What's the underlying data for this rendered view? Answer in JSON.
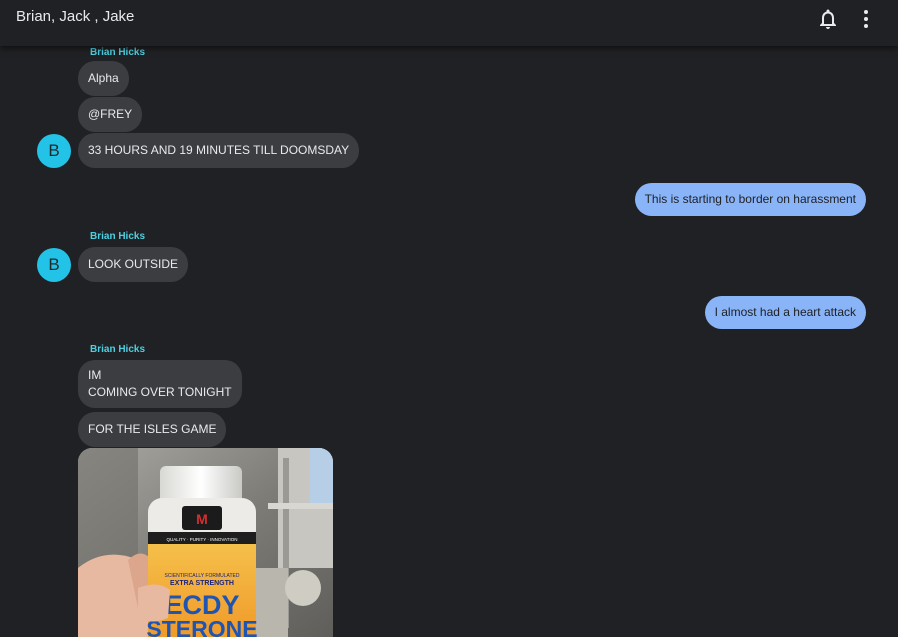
{
  "header": {
    "title": "Brian, Jack , Jake",
    "icons": [
      "bell-icon",
      "more-vert-icon"
    ]
  },
  "messages": [
    {
      "sender": "Brian Hicks",
      "avatar_letter": "B",
      "bubbles": [
        "Alpha",
        "@FREY",
        "33 HOURS AND 19 MINUTES TILL DOOMSDAY"
      ]
    },
    {
      "outgoing": "This is starting to border on harassment"
    },
    {
      "sender": "Brian Hicks",
      "avatar_letter": "B",
      "bubbles": [
        "LOOK OUTSIDE"
      ]
    },
    {
      "outgoing": "I almost had a heart attack"
    },
    {
      "sender": "Brian Hicks",
      "bubbles": [
        "IM\nCOMING OVER TONIGHT",
        "FOR THE ISLES GAME"
      ],
      "image": {
        "brand": "M",
        "label_small": "QUALITY · PURITY · INNOVATION",
        "label_formulated": "SCIENTIFICALLY FORMULATED",
        "label_strength": "EXTRA STRENGTH",
        "label_main_1": "ECDY",
        "label_main_2": "STERONE"
      }
    }
  ],
  "colors": {
    "background": "#202124",
    "incoming_bubble": "#3c3d40",
    "outgoing_bubble": "#8ab4f8",
    "sender_name": "#4dd0e1",
    "avatar": "#22c3e6"
  }
}
